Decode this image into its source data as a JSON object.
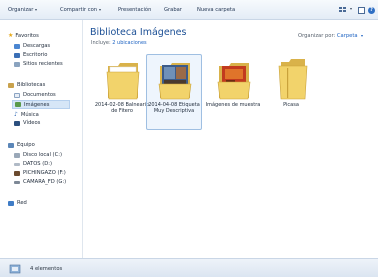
{
  "toolbar": {
    "organize_label": "Organizar",
    "share_label": "Compartir con",
    "slideshow_label": "Presentación",
    "burn_label": "Grabar",
    "new_folder_label": "Nueva carpeta",
    "help_label": "?"
  },
  "sidebar": {
    "favorites": {
      "label": "Favoritos",
      "items": [
        "Descargas",
        "Escritorio",
        "Sitios recientes"
      ]
    },
    "libraries": {
      "label": "Bibliotecas",
      "items": [
        "Documentos",
        "Imágenes",
        "Música",
        "Vídeos"
      ],
      "selected": "Imágenes"
    },
    "computer": {
      "label": "Equipo",
      "items": [
        "Disco local (C:)",
        "DATOS (D:)",
        "PICHINGAZO (F:)",
        "CAMARA_FD (G:)"
      ]
    },
    "network": {
      "label": "Red"
    }
  },
  "header": {
    "title": "Biblioteca Imágenes",
    "includes_prefix": "Incluye:",
    "includes_link": "2 ubicaciones",
    "arrange_label": "Organizar por:",
    "arrange_value": "Carpeta"
  },
  "folders": [
    {
      "label": "2014-02-08 Balneario de Fitero",
      "style": "plain",
      "selected": false
    },
    {
      "label": "2014-04-08 Etiqueta Muy Descriptiva",
      "style": "photo",
      "selected": true
    },
    {
      "label": "Imágenes de muestra",
      "style": "images",
      "selected": false
    },
    {
      "label": "Picasa",
      "style": "plain-tall",
      "selected": false
    }
  ],
  "status": {
    "text": "4 elementos"
  },
  "colors": {
    "accent": "#1b4f95",
    "link": "#1c62c2",
    "selection": "#d6e6f7",
    "folder": "#f2d36b"
  }
}
